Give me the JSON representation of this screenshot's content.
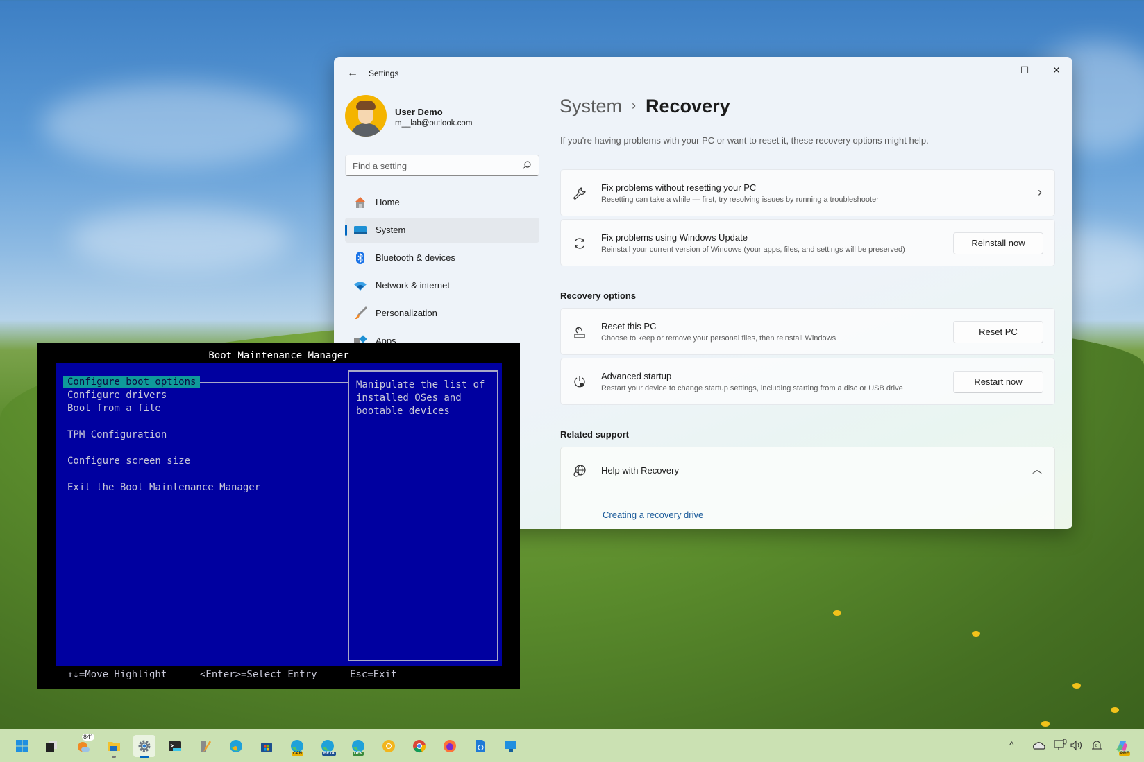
{
  "settings": {
    "app_title": "Settings",
    "window_controls": {
      "minimize": "—",
      "maximize": "☐",
      "close": "✕"
    },
    "back_icon": "←",
    "user": {
      "name": "User Demo",
      "email": "m__lab@outlook.com"
    },
    "search": {
      "placeholder": "Find a setting",
      "value": ""
    },
    "nav": [
      {
        "label": "Home",
        "icon": "home-icon",
        "active": false
      },
      {
        "label": "System",
        "icon": "system-icon",
        "active": true
      },
      {
        "label": "Bluetooth & devices",
        "icon": "bluetooth-icon",
        "active": false
      },
      {
        "label": "Network & internet",
        "icon": "wifi-icon",
        "active": false
      },
      {
        "label": "Personalization",
        "icon": "brush-icon",
        "active": false
      },
      {
        "label": "Apps",
        "icon": "apps-icon",
        "active": false
      }
    ],
    "breadcrumb": {
      "parent": "System",
      "separator": "›",
      "current": "Recovery"
    },
    "description": "If you're having problems with your PC or want to reset it, these recovery options might help.",
    "cards_top": [
      {
        "title": "Fix problems without resetting your PC",
        "subtitle": "Resetting can take a while — first, try resolving issues by running a troubleshooter",
        "icon": "wrench-icon",
        "action": "chevron"
      },
      {
        "title": "Fix problems using Windows Update",
        "subtitle": "Reinstall your current version of Windows (your apps, files, and settings will be preserved)",
        "icon": "sync-icon",
        "button": "Reinstall now"
      }
    ],
    "recovery_options": {
      "heading": "Recovery options",
      "items": [
        {
          "title": "Reset this PC",
          "subtitle": "Choose to keep or remove your personal files, then reinstall Windows",
          "icon": "reset-pc-icon",
          "button": "Reset PC"
        },
        {
          "title": "Advanced startup",
          "subtitle": "Restart your device to change startup settings, including starting from a disc or USB drive",
          "icon": "advanced-startup-icon",
          "button": "Restart now"
        }
      ]
    },
    "related_support": {
      "heading": "Related support",
      "help_title": "Help with Recovery",
      "expanded": true,
      "links": [
        "Creating a recovery drive"
      ]
    }
  },
  "boot_manager": {
    "title": "Boot Maintenance Manager",
    "items": [
      {
        "label": "Configure boot options",
        "selected": true
      },
      {
        "label": "Configure drivers",
        "selected": false
      },
      {
        "label": "Boot from a file",
        "selected": false
      },
      {
        "label": "TPM Configuration",
        "selected": false
      },
      {
        "label": "Configure screen size",
        "selected": false
      },
      {
        "label": "Exit the Boot Maintenance Manager",
        "selected": false
      }
    ],
    "help_text": [
      "Manipulate the list of",
      "installed OSes and",
      "bootable devices"
    ],
    "footer": {
      "move": "↑↓=Move Highlight",
      "select": "<Enter>=Select Entry",
      "exit": "Esc=Exit"
    }
  },
  "taskbar": {
    "weather_temp": "84°",
    "apps": [
      {
        "name": "start",
        "active": false
      },
      {
        "name": "task-view",
        "active": false
      },
      {
        "name": "weather",
        "active": false
      },
      {
        "name": "file-explorer",
        "active": false,
        "running": true
      },
      {
        "name": "settings",
        "active": true
      },
      {
        "name": "terminal",
        "active": false
      },
      {
        "name": "dev-tools",
        "active": false
      },
      {
        "name": "edge",
        "active": false
      },
      {
        "name": "store",
        "active": false
      },
      {
        "name": "edge-canary",
        "active": false,
        "badge": "CAN"
      },
      {
        "name": "edge-beta",
        "active": false,
        "badge": "BETA"
      },
      {
        "name": "edge-dev",
        "active": false,
        "badge": "DEV"
      },
      {
        "name": "chrome-canary",
        "active": false
      },
      {
        "name": "chrome",
        "active": false
      },
      {
        "name": "firefox",
        "active": false
      },
      {
        "name": "web-file",
        "active": false
      },
      {
        "name": "remote-desktop",
        "active": false
      }
    ],
    "tray": {
      "overflow": "^",
      "icons": [
        "onedrive",
        "network",
        "volume",
        "notifications"
      ],
      "copilot_badge": "PRE"
    }
  }
}
